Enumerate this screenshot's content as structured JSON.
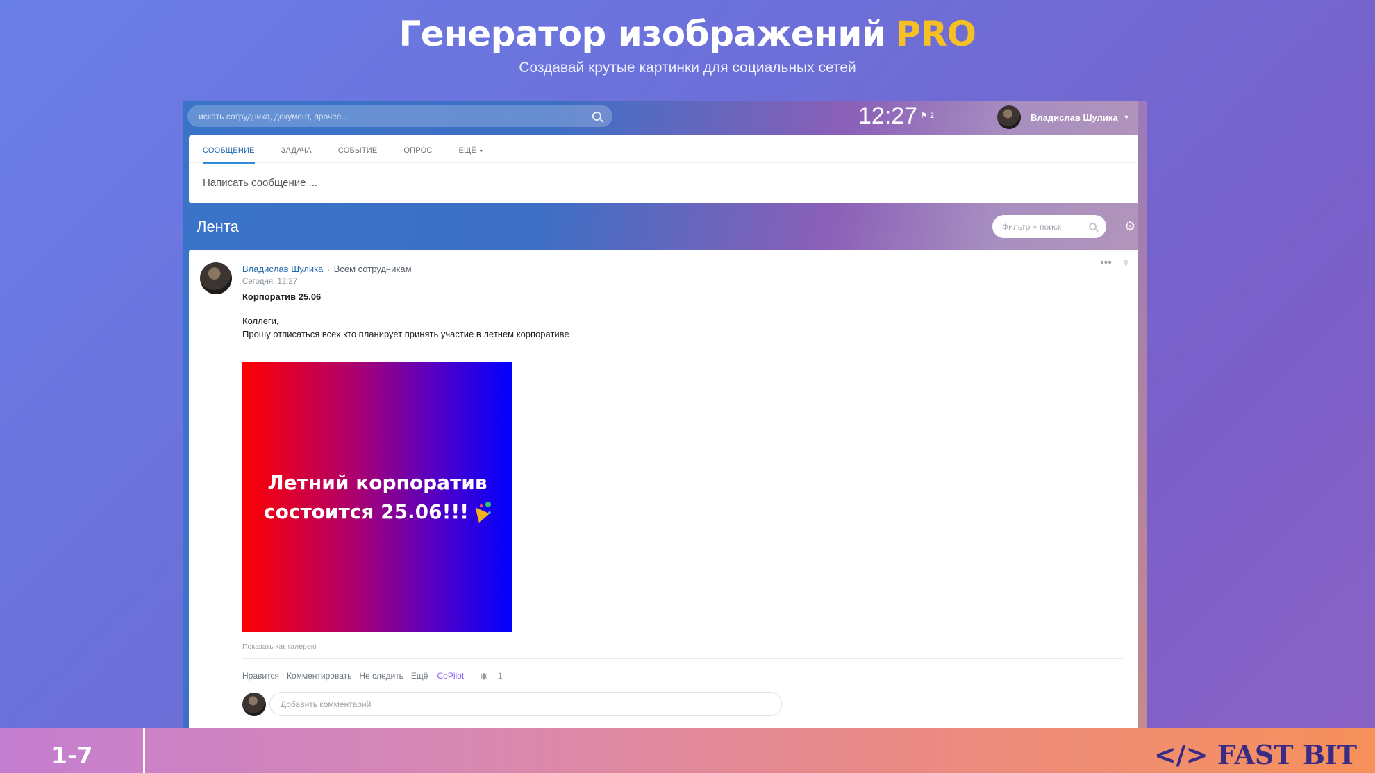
{
  "hero": {
    "title": "Генератор изображений",
    "title_highlight": "PRO",
    "subtitle": "Создавай крутые картинки для социальных сетей"
  },
  "topbar": {
    "search_placeholder": "искать сотрудника, документ, прочее...",
    "clock": "12:27",
    "flag_count": "2",
    "user_name": "Владислав Шулика"
  },
  "composer": {
    "tabs": [
      {
        "label": "СООБЩЕНИЕ"
      },
      {
        "label": "ЗАДАЧА"
      },
      {
        "label": "СОБЫТИЕ"
      },
      {
        "label": "ОПРОС"
      },
      {
        "label": "ЕЩЁ"
      }
    ],
    "placeholder": "Написать сообщение ..."
  },
  "feed": {
    "title": "Лента",
    "filter_placeholder": "Фильтр + поиск"
  },
  "post": {
    "author": "Владислав Шулика",
    "destination": "Всем сотрудникам",
    "date": "Сегодня, 12:27",
    "subject": "Корпоратив 25.06",
    "body_line1": "Коллеги,",
    "body_line2": "Прошу отписаться всех кто планирует принять участие в летнем корпоративе",
    "banner_line1": "Летний корпоратив",
    "banner_line2": "состоится 25.06!!!",
    "gallery_link": "Показать как галерею",
    "actions": {
      "like": "Нравится",
      "comment": "Комментировать",
      "unfollow": "Не следить",
      "more": "Ещё",
      "copilot": "CoPilot",
      "views": "1"
    },
    "comment_placeholder": "Добавить комментарий"
  },
  "footer": {
    "slide_number": "1-7",
    "brand": "</> FAST BIT"
  },
  "colors": {
    "accent": "#f5c024",
    "link": "#2067b0",
    "brand": "#3a2a88"
  }
}
